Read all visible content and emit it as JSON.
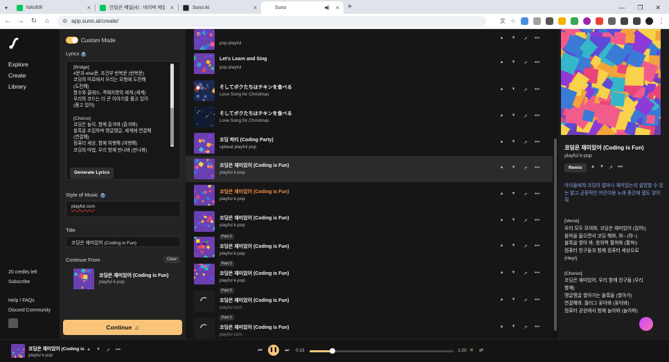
{
  "browser": {
    "tabs": [
      {
        "label": "NAVER",
        "color": "#03c75a"
      },
      {
        "label": "안읽은 메일(4) : 네이버 메일",
        "color": "#03c75a"
      },
      {
        "label": "Suno AI",
        "color": "#222222"
      },
      {
        "label": "Suno",
        "color": "#ffffff"
      }
    ],
    "url": "app.suno.ai/create/"
  },
  "nav": {
    "items": [
      "Explore",
      "Create",
      "Library"
    ],
    "credits": "20 credits left",
    "subscribe": "Subscribe",
    "help": "Help / FAQs",
    "discord": "Discord Community"
  },
  "create": {
    "custom_mode": "Custom Mode",
    "lyrics_label": "Lyrics",
    "lyrics": "[Bridge]\n#문과 else문, 조건부 반복문 (반복문)\n코딩의 미로에서 우리는 모험에 도전해\n(도전해)\n함수와 클래스, 객체지향의 세계 (세계)\n우리의 코드는 더 큰 이야기를 품고 있어\n(품고 있어)\n\n[Chorus]\n코딩은 놀이, 함께 즐겨봐 (즐겨봐)\n블록을 조립하며 땡글땡글, 세계에 연결해\n(연결해)\n컴퓨터 세상, 함께 여행해 (여행해)\n코딩의 마법, 우리 함께 만나봐 (만나봐)",
    "generate_lyrics": "Generate Lyrics",
    "style_label": "Style of Music",
    "style_value": "playful ccm",
    "title_label": "Title",
    "title_value": "코딩은 재미있어 (Coding is Fun)",
    "continue_from": "Continue From",
    "clear": "Clear",
    "continue_song_title": "코딩은 재미있어 (Coding is Fun)",
    "continue_song_tags": "playful k-pop",
    "continue_btn": "Continue"
  },
  "songs": [
    {
      "title": "",
      "tags": "pop playful",
      "badge": "",
      "state": "normal",
      "art": "cubes"
    },
    {
      "title": "Let's Learn and Sing",
      "tags": "pop playful",
      "badge": "",
      "state": "normal",
      "art": "colorful"
    },
    {
      "title": "そしてボクたちはチキンを食べる",
      "tags": "Love Song for Christmas",
      "badge": "",
      "state": "normal",
      "art": "christmas"
    },
    {
      "title": "そしてボクたちはチキンを食べる",
      "tags": "Love Song for Christmas",
      "badge": "",
      "state": "normal",
      "art": "night"
    },
    {
      "title": "코딩 파티 (Coding Party)",
      "tags": "upbeat playful pop",
      "badge": "",
      "state": "normal",
      "art": "party"
    },
    {
      "title": "코딩은 재미있어 (Coding is Fun)",
      "tags": "playful k-pop",
      "badge": "",
      "state": "selected",
      "art": "cubes"
    },
    {
      "title": "코딩은 재미있어 (Coding is Fun)",
      "tags": "playful k-pop",
      "badge": "",
      "state": "playing",
      "art": "cubes"
    },
    {
      "title": "코딩은 재미있어 (Coding is Fun)",
      "tags": "playful k-pop",
      "badge": "",
      "state": "normal",
      "art": "cubes"
    },
    {
      "title": "코딩은 재미있어 (Coding is Fun)",
      "tags": "playful k-pop",
      "badge": "Part 2",
      "state": "normal",
      "art": "blocks"
    },
    {
      "title": "코딩은 재미있어 (Coding is Fun)",
      "tags": "playful k-pop",
      "badge": "Part 2",
      "state": "normal",
      "art": "cubes"
    },
    {
      "title": "코딩은 재미있어 (Coding is Fun)",
      "tags": "playful ccm",
      "badge": "Part 2",
      "state": "loading",
      "art": "loading"
    },
    {
      "title": "코딩은 재미있어 (Coding is Fun)",
      "tags": "playful ccm",
      "badge": "Part 2",
      "state": "loading",
      "art": "loading"
    }
  ],
  "detail": {
    "title": "코딩은 재미있어 (Coding is Fun)",
    "tags": "playful k-pop",
    "remix": "Remix",
    "description": "아이들에게 코딩이 얼마나 재미있는지 설명할 수 있는 밝고 긍정적인 어린이용 노래 중간에 랩도 넣어줘",
    "lyrics": "[Verse]\n우리 모두 모여봐, 코딩은 재미있어 (있어!)\n음악을 들으면서 코딩 해봐, 와~ (와~)\n블록을 쌓아 봐, 창의력 펼쳐봐 (펼쳐!)\n컴퓨터 친구들과 함께 컴퓨터 세상으로\n(Hey!)\n\n[Chorus]\n코딩은 재미있어, 우리 함께 친구들 (우리\n함께)\n땡글땡글 쌓아가는 블록들 (쌓아가)\n연결해봐, 플러그 꽂아봐 (꽂아봐)\n컴퓨터 공원에서 함께 놀아봐 (놀아봐)"
  },
  "player": {
    "title": "코딩은 재미있어 (Coding is",
    "tags": "playful k-pop",
    "elapsed": "0:13",
    "duration": "1:20",
    "progress": 0.16
  }
}
